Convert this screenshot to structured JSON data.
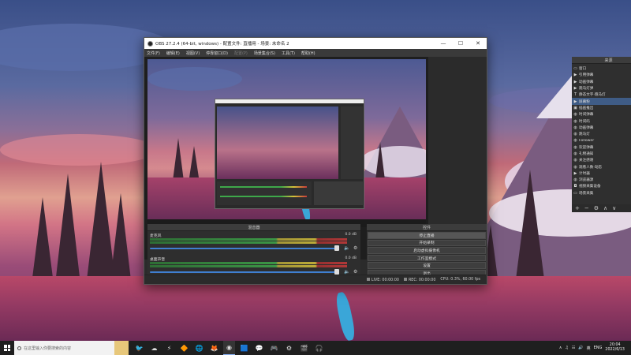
{
  "window": {
    "title": "OBS 27.2.4 (64-bit, windows) - 配置文件: 直播用 - 场景: 未命名 2",
    "minimize": "—",
    "maximize": "☐",
    "close": "✕"
  },
  "menu": {
    "items": [
      "文件(F)",
      "编辑(E)",
      "视图(V)",
      "停靠窗口(D)",
      "配置(P)",
      "场景集合(S)",
      "工具(T)",
      "帮助(H)"
    ]
  },
  "sources": {
    "title": "来源",
    "items": [
      {
        "label": "窗口",
        "icon": "window-icon"
      },
      {
        "label": "引用弹幕",
        "icon": "play-icon"
      },
      {
        "label": "动画弹幕",
        "icon": "play-icon"
      },
      {
        "label": "跑马灯弹",
        "icon": "play-icon"
      },
      {
        "label": "静态文字·跑马灯",
        "icon": "text-icon"
      },
      {
        "label": "屏幕粉",
        "icon": "play-icon",
        "selected": true
      },
      {
        "label": "插画推出",
        "icon": "image-icon"
      },
      {
        "label": "时间弹幕",
        "icon": "globe-icon"
      },
      {
        "label": "时间码",
        "icon": "globe-icon"
      },
      {
        "label": "动画弹幕",
        "icon": "globe-icon"
      },
      {
        "label": "跑马灯",
        "icon": "globe-icon"
      },
      {
        "label": "Follower",
        "icon": "globe-icon"
      },
      {
        "label": "欢迎弹幕",
        "icon": "globe-icon"
      },
      {
        "label": "礼物通知",
        "icon": "globe-icon"
      },
      {
        "label": "关注感谢",
        "icon": "globe-icon"
      },
      {
        "label": "观看人数·动态",
        "icon": "globe-icon"
      },
      {
        "label": "计时器",
        "icon": "play-icon"
      },
      {
        "label": "浏览器源",
        "icon": "globe-icon"
      },
      {
        "label": "视频采集设备",
        "icon": "camera-icon"
      },
      {
        "label": "场景采集",
        "icon": "window-icon"
      }
    ],
    "tools": [
      "+",
      "−",
      "⚙",
      "∧",
      "∨"
    ]
  },
  "mixer": {
    "title": "混音器",
    "tracks": [
      {
        "name": "麦克风",
        "db": "0.0 dB",
        "level": 0.98
      },
      {
        "name": "桌面声音",
        "db": "0.0 dB",
        "level": 0.98
      }
    ]
  },
  "controls": {
    "title": "控件",
    "buttons": [
      "停止直播",
      "开始录制",
      "启动虚拟摄像机",
      "工作室模式",
      "设置",
      "退出"
    ]
  },
  "status": {
    "dropped": "LIVE: 00:00:00",
    "rec": "REC: 00:00:00",
    "cpu": "CPU: 0.3%, 60.00 fps"
  },
  "taskbar": {
    "search_placeholder": "在这里输入你要搜索的内容",
    "apps": [
      "🐦",
      "☁",
      "⚡",
      "🔶",
      "🌐",
      "🦊",
      "◉",
      "🟦",
      "💬",
      "🎮",
      "⚙",
      "🎬",
      "🎧"
    ],
    "tray": [
      "∧",
      "♫",
      "☷",
      "🔊",
      "英"
    ],
    "lang": "ENG",
    "time": "20:04",
    "date": "2022/6/13"
  }
}
